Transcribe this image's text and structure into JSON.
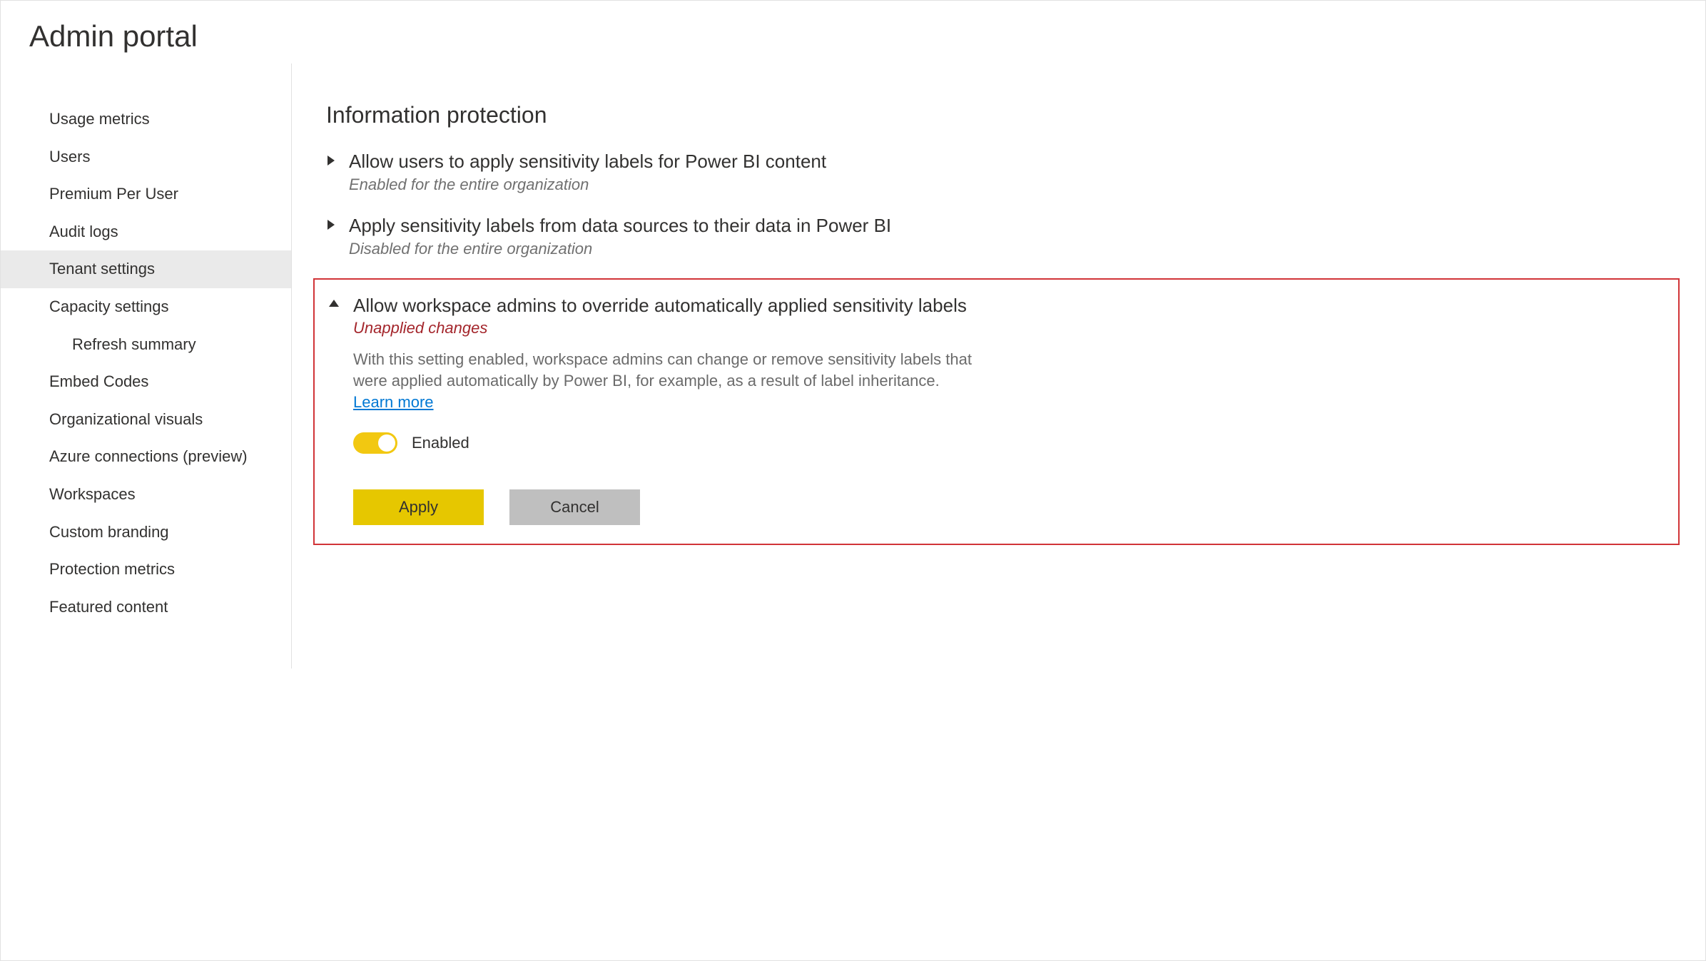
{
  "header": {
    "title": "Admin portal"
  },
  "sidebar": {
    "items": [
      {
        "label": "Usage metrics",
        "selected": false,
        "indented": false
      },
      {
        "label": "Users",
        "selected": false,
        "indented": false
      },
      {
        "label": "Premium Per User",
        "selected": false,
        "indented": false
      },
      {
        "label": "Audit logs",
        "selected": false,
        "indented": false
      },
      {
        "label": "Tenant settings",
        "selected": true,
        "indented": false
      },
      {
        "label": "Capacity settings",
        "selected": false,
        "indented": false
      },
      {
        "label": "Refresh summary",
        "selected": false,
        "indented": true
      },
      {
        "label": "Embed Codes",
        "selected": false,
        "indented": false
      },
      {
        "label": "Organizational visuals",
        "selected": false,
        "indented": false
      },
      {
        "label": "Azure connections (preview)",
        "selected": false,
        "indented": false
      },
      {
        "label": "Workspaces",
        "selected": false,
        "indented": false
      },
      {
        "label": "Custom branding",
        "selected": false,
        "indented": false
      },
      {
        "label": "Protection metrics",
        "selected": false,
        "indented": false
      },
      {
        "label": "Featured content",
        "selected": false,
        "indented": false
      }
    ]
  },
  "main": {
    "section_heading": "Information protection",
    "settings": [
      {
        "title": "Allow users to apply sensitivity labels for Power BI content",
        "status": "Enabled for the entire organization",
        "expanded": false
      },
      {
        "title": "Apply sensitivity labels from data sources to their data in Power BI",
        "status": "Disabled for the entire organization",
        "expanded": false
      },
      {
        "title": "Allow workspace admins to override automatically applied sensitivity labels",
        "status": "Unapplied changes",
        "status_warn": true,
        "expanded": true,
        "description": "With this setting enabled, workspace admins can change or remove sensitivity labels that were applied automatically by Power BI, for example, as a result of label inheritance.",
        "learn_more": "Learn more",
        "toggle_state": "Enabled",
        "apply_label": "Apply",
        "cancel_label": "Cancel"
      }
    ]
  }
}
